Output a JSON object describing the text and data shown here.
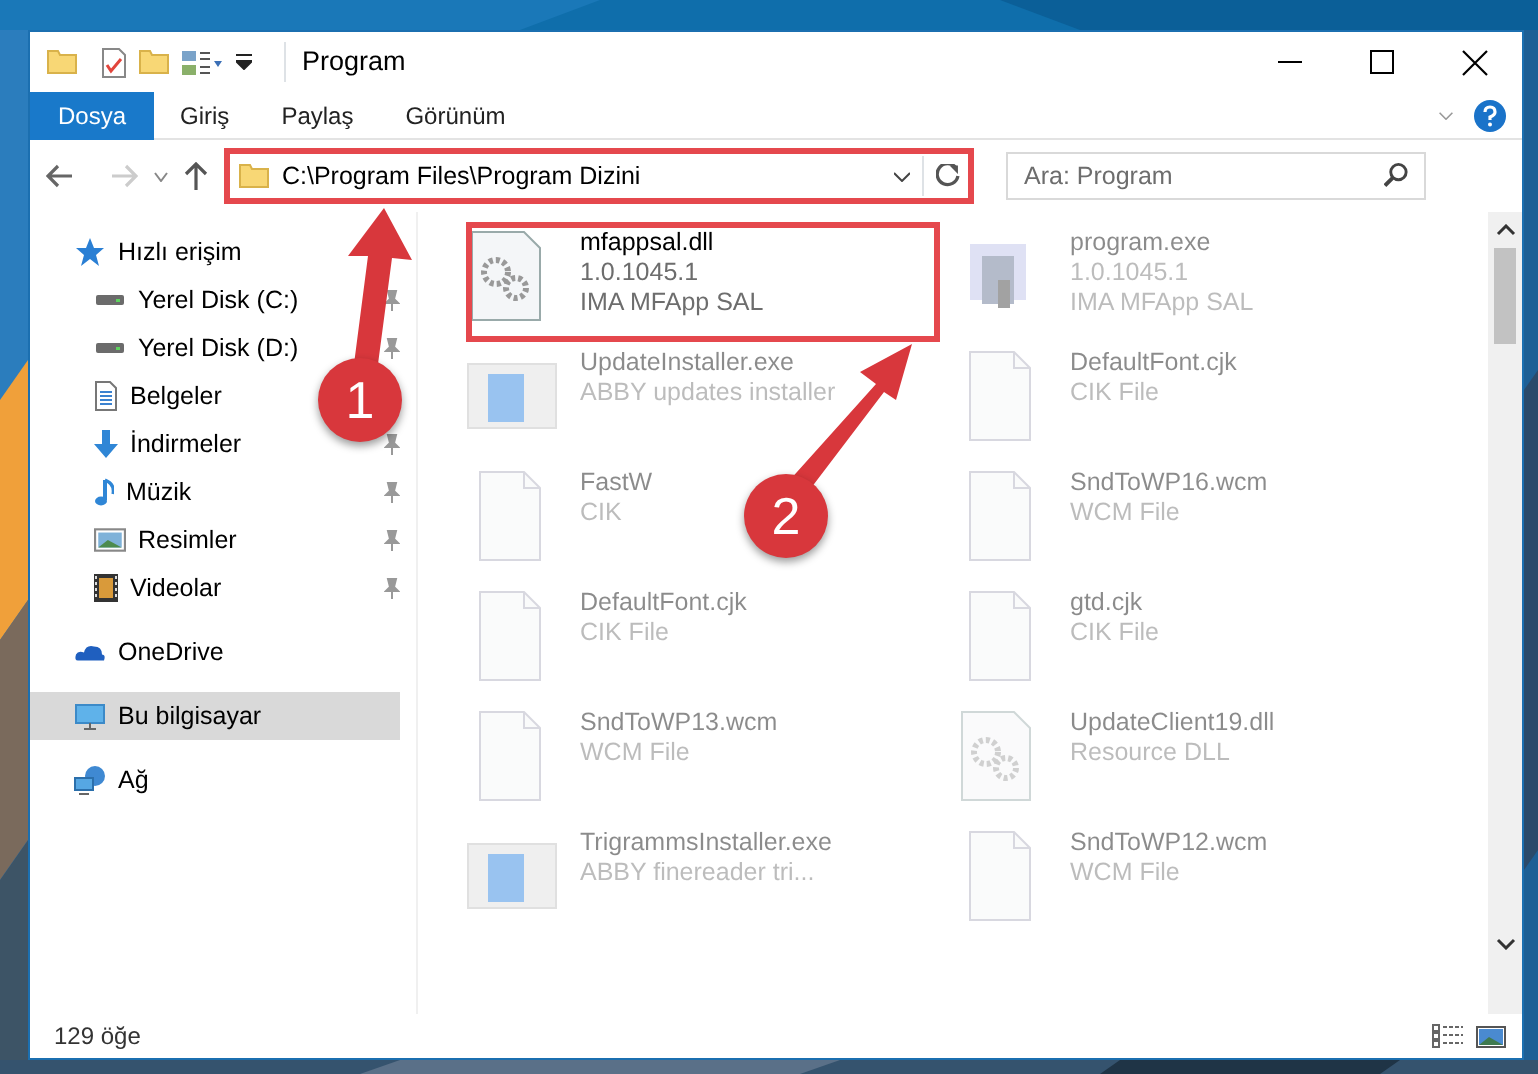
{
  "window": {
    "title": "Program"
  },
  "ribbon_tabs": [
    {
      "label": "Dosya",
      "selected": true
    },
    {
      "label": "Giriş",
      "selected": false
    },
    {
      "label": "Paylaş",
      "selected": false
    },
    {
      "label": "Görünüm",
      "selected": false
    }
  ],
  "address": {
    "path": "C:\\Program Files\\Program Dizini"
  },
  "search": {
    "placeholder": "Ara: Program"
  },
  "nav": [
    {
      "label": "Hızlı erişim",
      "kind": "star",
      "pinned": false,
      "selected": false,
      "children": [
        {
          "label": "Yerel Disk (C:)",
          "kind": "drive",
          "pinned": true,
          "selected": false
        },
        {
          "label": "Yerel Disk (D:)",
          "kind": "drive",
          "pinned": true,
          "selected": false
        },
        {
          "label": "Belgeler",
          "kind": "docs",
          "pinned": false,
          "selected": false
        },
        {
          "label": "İndirmeler",
          "kind": "download",
          "pinned": true,
          "selected": false
        },
        {
          "label": "Müzik",
          "kind": "music",
          "pinned": true,
          "selected": false
        },
        {
          "label": "Resimler",
          "kind": "pictures",
          "pinned": true,
          "selected": false
        },
        {
          "label": "Videolar",
          "kind": "video",
          "pinned": true,
          "selected": false
        }
      ]
    },
    {
      "label": "OneDrive",
      "kind": "cloud",
      "pinned": false,
      "selected": false
    },
    {
      "label": "Bu bilgisayar",
      "kind": "pc",
      "pinned": false,
      "selected": true
    },
    {
      "label": "Ağ",
      "kind": "network",
      "pinned": false,
      "selected": false
    }
  ],
  "files": [
    {
      "name": "mfappsal.dll",
      "details": [
        "1.0.1045.1",
        "IMA MFApp SAL"
      ],
      "kind": "dll",
      "focused": true
    },
    {
      "name": "program.exe",
      "details": [
        "1.0.1045.1",
        "IMA MFApp SAL"
      ],
      "kind": "program",
      "focused": false
    },
    {
      "name": "UpdateInstaller.exe",
      "details": [
        "ABBY updates installer"
      ],
      "kind": "installer",
      "focused": false
    },
    {
      "name": "DefaultFont.cjk",
      "details": [
        "CIK File"
      ],
      "kind": "doc",
      "focused": false
    },
    {
      "name": "FastW",
      "details": [
        "CIK"
      ],
      "kind": "doc",
      "focused": false
    },
    {
      "name": "SndToWP16.wcm",
      "details": [
        "WCM File"
      ],
      "kind": "doc",
      "focused": false
    },
    {
      "name": "DefaultFont.cjk",
      "details": [
        "CIK File"
      ],
      "kind": "doc",
      "focused": false
    },
    {
      "name": "gtd.cjk",
      "details": [
        "CIK File"
      ],
      "kind": "doc",
      "focused": false
    },
    {
      "name": "SndToWP13.wcm",
      "details": [
        "WCM File"
      ],
      "kind": "doc",
      "focused": false
    },
    {
      "name": "UpdateClient19.dll",
      "details": [
        "Resource DLL"
      ],
      "kind": "dll",
      "focused": false
    },
    {
      "name": "TrigrammsInstaller.exe",
      "details": [
        "ABBY finereader tri..."
      ],
      "kind": "installer",
      "focused": false
    },
    {
      "name": "SndToWP12.wcm",
      "details": [
        "WCM File"
      ],
      "kind": "doc",
      "focused": false
    }
  ],
  "status_bar": {
    "count": "129 öğe"
  },
  "annotations": [
    "1",
    "2"
  ]
}
